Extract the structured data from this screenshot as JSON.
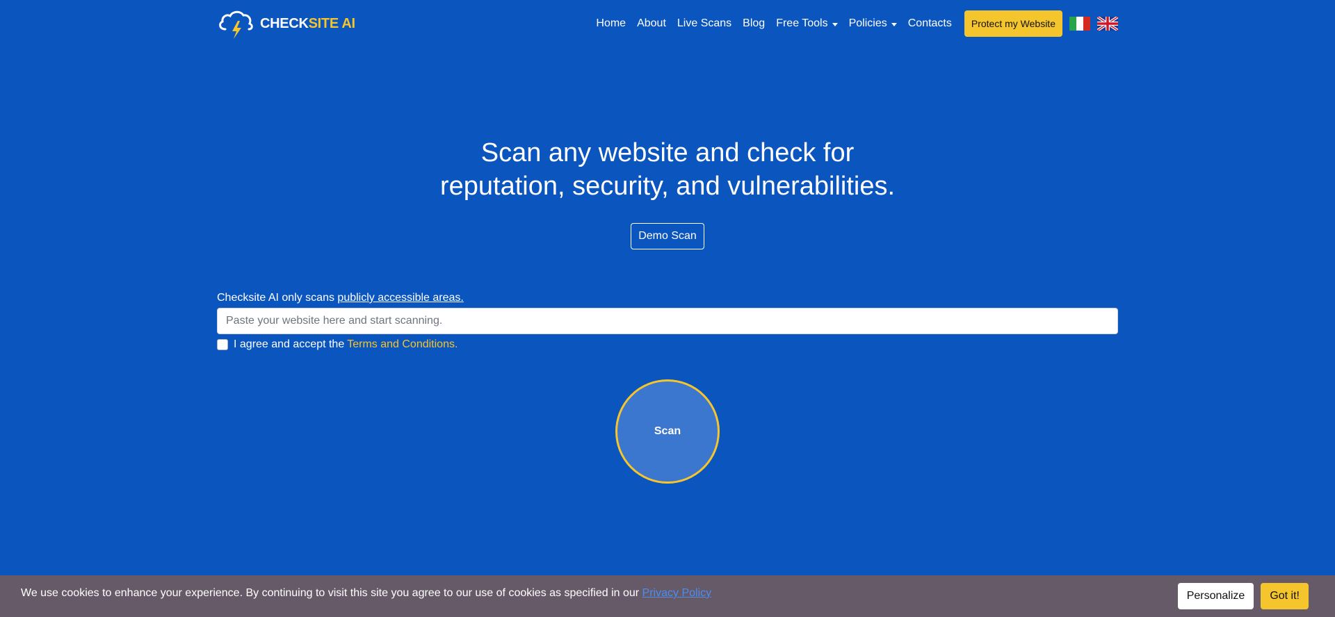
{
  "brand": {
    "name_part1": "CHECK",
    "name_part2": "SITE AI",
    "logo_icon": "cloud-lightning-icon"
  },
  "nav": {
    "items": [
      {
        "label": "Home"
      },
      {
        "label": "About"
      },
      {
        "label": "Live Scans"
      },
      {
        "label": "Blog"
      },
      {
        "label": "Free Tools",
        "dropdown": true
      },
      {
        "label": "Policies",
        "dropdown": true
      },
      {
        "label": "Contacts"
      }
    ],
    "protect_label": "Protect my Website",
    "flags": [
      "italy-flag-icon",
      "uk-flag-icon"
    ]
  },
  "hero": {
    "title_line1": "Scan any website and check for",
    "title_line2": "reputation, security, and vulnerabilities.",
    "demo_label": "Demo Scan"
  },
  "form": {
    "note_text": "Checksite AI only scans ",
    "note_link": "publicly accessible areas.",
    "url_placeholder": "Paste your website here and start scanning.",
    "url_value": "",
    "agree_text": "I agree and accept the",
    "terms_link": "Terms and Conditions.",
    "agree_checked": false
  },
  "scan": {
    "label": "Scan"
  },
  "cookie": {
    "text": "We use cookies to enhance your experience. By continuing to visit this site you agree to our use of cookies as specified in our ",
    "link": "Privacy Policy",
    "personalize_label": "Personalize",
    "gotit_label": "Got it!"
  },
  "colors": {
    "background": "#0b55bf",
    "accent": "#f5c52d",
    "cookie_bar": "#675a68"
  }
}
